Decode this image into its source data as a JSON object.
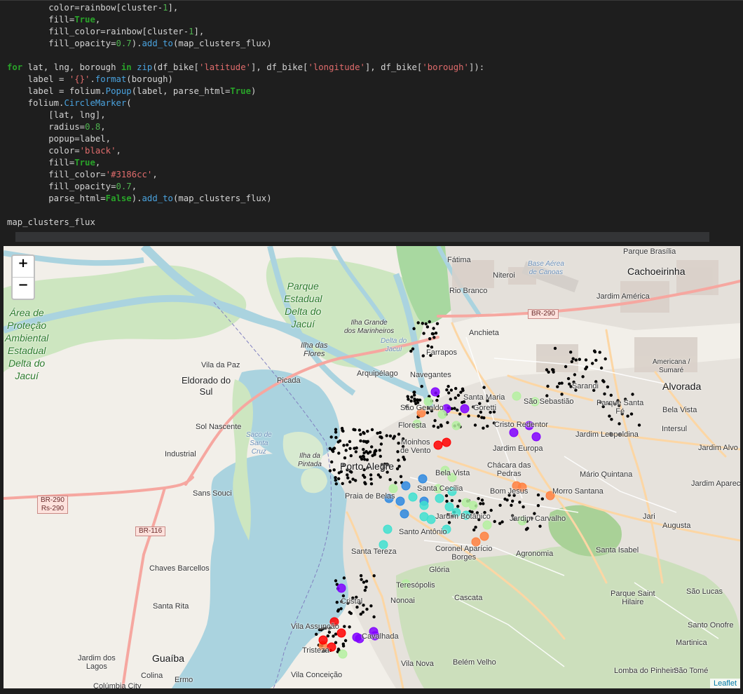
{
  "code_cell": {
    "lines": [
      [
        [
          "        color=rainbow[cluster-",
          ""
        ],
        [
          "1",
          "num"
        ],
        [
          "],",
          ""
        ]
      ],
      [
        [
          "        fill=",
          ""
        ],
        [
          "True",
          "kw"
        ],
        [
          ",",
          ""
        ]
      ],
      [
        [
          "        fill_color=rainbow[cluster-",
          ""
        ],
        [
          "1",
          "num"
        ],
        [
          "],",
          ""
        ]
      ],
      [
        [
          "        fill_opacity=",
          ""
        ],
        [
          "0.7",
          "num"
        ],
        [
          ").",
          ""
        ],
        [
          "add_to",
          "fn"
        ],
        [
          "(map_clusters_flux)",
          ""
        ]
      ],
      [
        [
          "",
          ""
        ]
      ],
      [
        [
          "for",
          "kw"
        ],
        [
          " lat, lng, borough ",
          ""
        ],
        [
          "in",
          "kw"
        ],
        [
          " ",
          ""
        ],
        [
          "zip",
          "fn"
        ],
        [
          "(df_bike[",
          ""
        ],
        [
          "'latitude'",
          "str"
        ],
        [
          "], df_bike[",
          ""
        ],
        [
          "'longitude'",
          "str"
        ],
        [
          "], df_bike[",
          ""
        ],
        [
          "'borough'",
          "str"
        ],
        [
          "]):",
          ""
        ]
      ],
      [
        [
          "    label = ",
          ""
        ],
        [
          "'{}'",
          "str"
        ],
        [
          ".",
          ""
        ],
        [
          "format",
          "fn"
        ],
        [
          "(borough)",
          ""
        ]
      ],
      [
        [
          "    label = folium.",
          ""
        ],
        [
          "Popup",
          "fn"
        ],
        [
          "(label, parse_html=",
          ""
        ],
        [
          "True",
          "kw"
        ],
        [
          ")",
          ""
        ]
      ],
      [
        [
          "    folium.",
          ""
        ],
        [
          "CircleMarker",
          "fn"
        ],
        [
          "(",
          ""
        ]
      ],
      [
        [
          "        [lat, lng],",
          ""
        ]
      ],
      [
        [
          "        radius=",
          ""
        ],
        [
          "0.8",
          "num"
        ],
        [
          ",",
          ""
        ]
      ],
      [
        [
          "        popup=label,",
          ""
        ]
      ],
      [
        [
          "        color=",
          ""
        ],
        [
          "'black'",
          "str"
        ],
        [
          ",",
          ""
        ]
      ],
      [
        [
          "        fill=",
          ""
        ],
        [
          "True",
          "kw"
        ],
        [
          ",",
          ""
        ]
      ],
      [
        [
          "        fill_color=",
          ""
        ],
        [
          "'#3186cc'",
          "str"
        ],
        [
          ",",
          ""
        ]
      ],
      [
        [
          "        fill_opacity=",
          ""
        ],
        [
          "0.7",
          "num"
        ],
        [
          ",",
          ""
        ]
      ],
      [
        [
          "        parse_html=",
          ""
        ],
        [
          "False",
          "kw"
        ],
        [
          ").",
          ""
        ],
        [
          "add_to",
          "fn"
        ],
        [
          "(map_clusters_flux)",
          ""
        ]
      ],
      [
        [
          "",
          ""
        ]
      ],
      [
        [
          "map_clusters_flux",
          ""
        ]
      ]
    ]
  },
  "map": {
    "zoom_in_label": "+",
    "zoom_out_label": "−",
    "attribution": "Leaflet",
    "labels": {
      "parque_brasilia": "Parque Brasília",
      "fatima": "Fátima",
      "niteroi": "Niteroi",
      "base_aerea": "Base Aérea\nde Canoas",
      "cachoeirinha": "Cachoeirinha",
      "rio_branco": "Rio Branco",
      "jardim_america": "Jardim América",
      "parque_estadual": "Parque\nEstadual\nDelta do\nJacuí",
      "area_protecao": "Área de\nProteção\nAmbiental\nEstadual\nDelta do\nJacuí",
      "ilha_grande": "Ilha Grande\ndos Marinheiros",
      "delta_jacui": "Delta do\nJacuí",
      "anchieta": "Anchieta",
      "ilha_flores": "Ilha das\nFlores",
      "farrapos": "Farrapos",
      "vila_da_paz": "Vila da Paz",
      "eldorado": "Eldorado do\nSul",
      "picada": "Picada",
      "arquipelago": "Arquipélago",
      "navegantes": "Navegantes",
      "americana": "Americana /\nSumaré",
      "alvorada": "Alvorada",
      "sarandi": "Sarandi",
      "santa_maria": "Santa Maria",
      "sao_sebastiao": "São Sebastião",
      "parque_santa_fe": "Parque Santa\nFé",
      "sao_geraldo": "São Geraldo",
      "goretti": "Goretti",
      "bela_vista_n": "Bela Vista",
      "sol_nascente": "Sol Nascente",
      "floresta": "Floresta",
      "cristo_redentor": "Cristo Redentor",
      "intersul": "Intersul",
      "saco_santa_cruz": "Saco de\nSanta\nCruz",
      "jardim_leopoldina": "Jardim Leopoldina",
      "jardim_alvo": "Jardim Alvo",
      "moinhos": "Moinhos\nde Vento",
      "jardim_europa": "Jardim Europa",
      "industrial": "Industrial",
      "ilha_pintada": "Ilha da\nPintada",
      "porto_alegre": "Porto Alegre",
      "chacara": "Chácara das\nPedras",
      "bela_vista": "Bela Vista",
      "mario_quintana": "Mário Quintana",
      "jardim_aparec": "Jardim Aparec",
      "br290": "BR-290",
      "br290_rs": "BR-290\nRs-290",
      "sans_souci": "Sans Souci",
      "praia_belas": "Praia de Belas",
      "santa_cecilia": "Santa Cecília",
      "bom_jesus": "Bom Jesus",
      "morro_santana": "Morro Santana",
      "jardim_botanico": "Jardim Botânico",
      "jardim_carvalho": "Jardim Carvalho",
      "jari": "Jari",
      "augusta": "Augusta",
      "br116": "BR-116",
      "santo_antonio": "Santo Antônio",
      "santa_tereza": "Santa Tereza",
      "coronel_aparicio": "Coronel Aparício\nBorges",
      "agronomia": "Agronomia",
      "santa_isabel": "Santa Isabel",
      "chaves_barcellos": "Chaves Barcellos",
      "gloria": "Glória",
      "teresopolis": "Teresópolis",
      "cascata": "Cascata",
      "parque_saint_hilaire": "Parque Saint\nHilaire",
      "sao_lucas": "São Lucas",
      "cristal": "Cristal",
      "nonoai": "Nonoai",
      "santa_rita": "Santa Rita",
      "vila_assuncao": "Vila Assunção",
      "cavalhada": "Cavalhada",
      "santo_onofre": "Santo Onofre",
      "martinica": "Martinica",
      "tristeza": "Tristeza",
      "jardim_lagos": "Jardim dos\nLagos",
      "guaiba": "Guaíba",
      "vila_nova": "Vila Nova",
      "belem_velho": "Belém Velho",
      "colina": "Colina",
      "ermo": "Ermo",
      "vila_conceicao": "Vila Conceição",
      "lomba_pinheiro": "Lomba do Pinheiro",
      "sao_tome": "São Tomé",
      "colombia_city": "Colúmbia City"
    },
    "cluster_markers": [
      {
        "color": "#8000ff",
        "count": 11
      },
      {
        "color": "#2d88e0",
        "count": 6
      },
      {
        "color": "#40e0d0",
        "count": 12
      },
      {
        "color": "#b4f0a0",
        "count": 16
      },
      {
        "color": "#ff8040",
        "count": 7
      },
      {
        "color": "#ff0000",
        "count": 6
      }
    ],
    "station_marker_color": "#000000"
  }
}
